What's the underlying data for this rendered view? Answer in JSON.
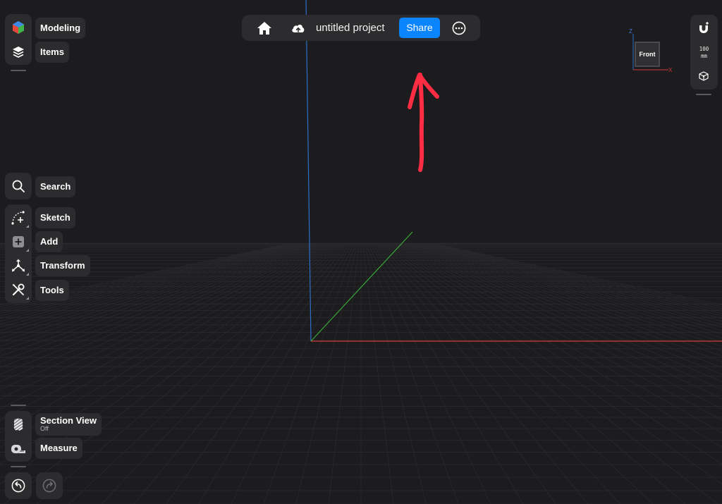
{
  "colors": {
    "background": "#1c1c1e",
    "panel": "#2c2c2e",
    "accent_share": "#0a84ff",
    "axis_x": "#d0383a",
    "axis_y": "#38a83a",
    "axis_z": "#2d6fc8",
    "annotation_arrow": "#ff2d43"
  },
  "topbar": {
    "home_icon": "home-icon",
    "cloud_icon": "cloud-upload-icon",
    "project_title": "untitled project",
    "share_label": "Share",
    "more_icon": "ellipsis-circle-icon"
  },
  "left_top": {
    "modeling_label": "Modeling",
    "items_label": "Items"
  },
  "left_tools": {
    "search_label": "Search",
    "sketch_label": "Sketch",
    "add_label": "Add",
    "transform_label": "Transform",
    "tools_label": "Tools"
  },
  "left_bottom": {
    "section_view_label": "Section View",
    "section_view_state": "Off",
    "measure_label": "Measure"
  },
  "history": {
    "undo_icon": "undo-icon",
    "redo_icon": "redo-icon"
  },
  "viewcube": {
    "face_label": "Front",
    "axis_z_label": "Z",
    "axis_x_label": "X"
  },
  "right_panel": {
    "grid_size_value": "100",
    "grid_size_unit": "mm",
    "snap_icon": "magnet-snap-icon",
    "cube_icon": "cube-icon"
  },
  "annotation": {
    "arrow": "hand-drawn-red-arrow"
  }
}
